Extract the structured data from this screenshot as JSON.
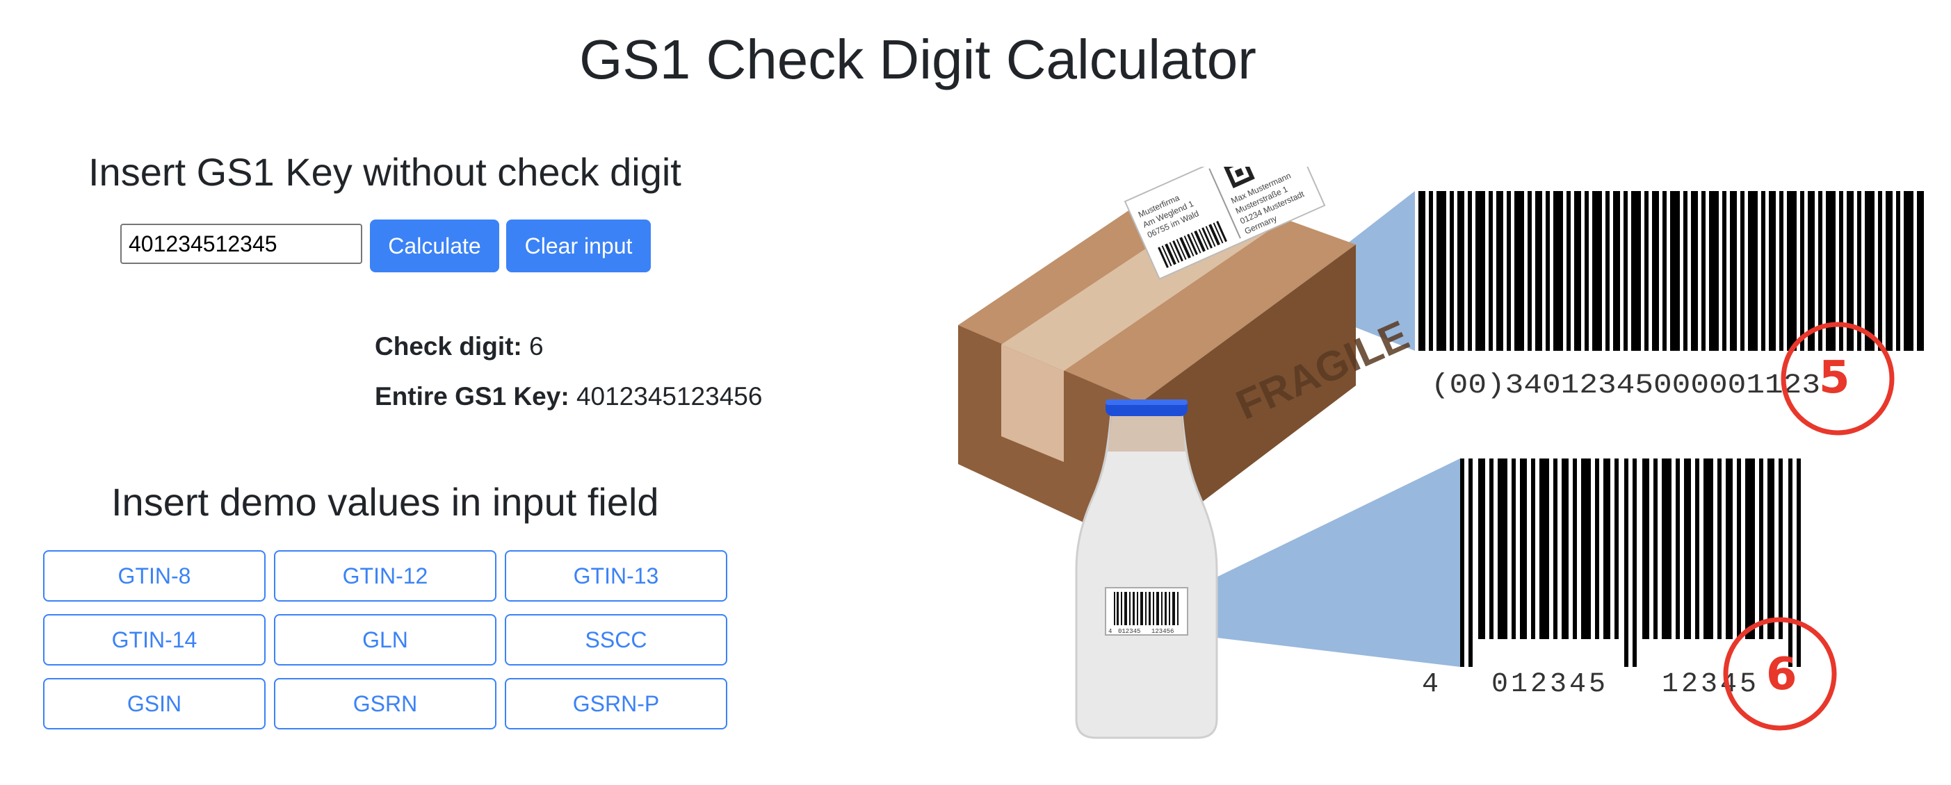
{
  "page": {
    "title": "GS1 Check Digit Calculator"
  },
  "calculator": {
    "heading": "Insert GS1 Key without check digit",
    "input_value": "401234512345",
    "calculate_label": "Calculate",
    "clear_label": "Clear input",
    "check_digit_label": "Check digit:",
    "check_digit_value": "6",
    "entire_key_label": "Entire GS1 Key:",
    "entire_key_value": "4012345123456"
  },
  "demo": {
    "heading": "Insert demo values in input field",
    "buttons": [
      "GTIN-8",
      "GTIN-12",
      "GTIN-13",
      "GTIN-14",
      "GLN",
      "SSCC",
      "GSIN",
      "GSRN",
      "GSRN-P"
    ]
  },
  "illustration": {
    "box_label": "FRAGILE",
    "sender_lines": [
      "Musterfirma",
      "Am Weglend 1",
      "06755 im Wald"
    ],
    "recipient_lines": [
      "Max Mustermann",
      "Musterstraße 1",
      "01234 Musterstadt",
      "Germany"
    ],
    "sscc_text": "(00)34012345000001123",
    "sscc_check_digit": "5",
    "ean_text": [
      "4",
      "012345",
      "12345"
    ],
    "ean_check_digit": "6",
    "bottle_label_text": [
      "4",
      "012345",
      "123456"
    ],
    "colors": {
      "accent": "#3b82f6",
      "highlight": "#e8372b",
      "beam": "#7ea6d4",
      "cardboard": "#9c6c44",
      "cap": "#1d4ed8"
    }
  }
}
